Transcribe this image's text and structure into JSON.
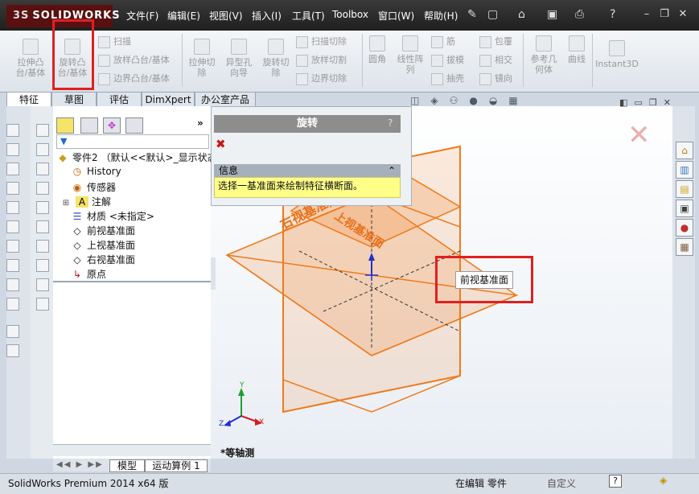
{
  "app": {
    "brand": "SOLIDWORKS",
    "brand_prefix": "3S"
  },
  "menu": [
    "文件(F)",
    "编辑(E)",
    "视图(V)",
    "插入(I)",
    "工具(T)",
    "Toolbox",
    "窗口(W)",
    "帮助(H)"
  ],
  "ribbon": {
    "extrude_boss": "拉伸凸\n台/基体",
    "revolve_boss": "旋转凸\n台/基体",
    "sweep": "扫描",
    "loft_boss": "放样凸台/基体",
    "boundary_boss": "边界凸台/基体",
    "extrude_cut": "拉伸切\n除",
    "hole_wizard": "异型孔\n向导",
    "revolve_cut": "旋转切\n除",
    "swept_cut": "扫描切除",
    "lofted_cut": "放样切割",
    "boundary_cut": "边界切除",
    "fillet": "圆角",
    "linear_pattern": "线性阵\n列",
    "rib": "筋",
    "draft": "拔模",
    "shell": "抽壳",
    "wrap": "包覆",
    "intersect": "相交",
    "mirror": "镜向",
    "ref_geometry": "参考几\n何体",
    "curves": "曲线",
    "instant3d": "Instant3D"
  },
  "tabs": [
    "特征",
    "草图",
    "评估",
    "DimXpert",
    "办公室产品"
  ],
  "tree": {
    "root": "零件2 （默认<<默认>_显示状态",
    "items": [
      "History",
      "传感器",
      "注解",
      "材质 <未指定>",
      "前视基准面",
      "上视基准面",
      "右视基准面",
      "原点"
    ]
  },
  "property_manager": {
    "title": "旋转",
    "help": "?",
    "message_header": "信息",
    "message": "选择一基准面来绘制特征横断面。"
  },
  "viewport": {
    "plane_label_right": "右视基准面",
    "plane_label_top": "上视基准面",
    "tooltip": "前视基准面",
    "view_name": "*等轴测"
  },
  "bottom_tabs": [
    "模型",
    "运动算例 1"
  ],
  "status": {
    "left": "SolidWorks Premium 2014 x64 版",
    "mode": "在编辑 零件",
    "custom": "自定义",
    "help": "?"
  },
  "colors": {
    "plane": "#f07a1a",
    "highlight_box": "#e02020",
    "pm_message_bg": "#ffff88"
  }
}
